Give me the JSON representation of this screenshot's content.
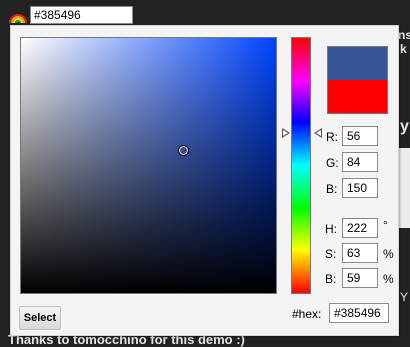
{
  "toolbar": {
    "hex_value": "#385496",
    "rainbow_icon": "rainbow-icon"
  },
  "background": {
    "footer_text": "Thanks to tomocchino for this demo :)",
    "frag_ns": "ns",
    "frag_k": "k",
    "frag_y1": "y",
    "frag_y2": "Y"
  },
  "picker": {
    "colors": {
      "new": "#385496",
      "old": "#ff0000"
    },
    "rgb": {
      "r_label": "R:",
      "r_value": "56",
      "g_label": "G:",
      "g_value": "84",
      "b_label": "B:",
      "b_value": "150"
    },
    "hsb": {
      "h_label": "H:",
      "h_value": "222",
      "h_unit": "°",
      "s_label": "S:",
      "s_value": "63",
      "s_unit": "%",
      "b_label": "B:",
      "b_value": "59",
      "b_unit": "%"
    },
    "hex": {
      "label": "#hex:",
      "value": "#385496"
    },
    "select_label": "Select"
  }
}
